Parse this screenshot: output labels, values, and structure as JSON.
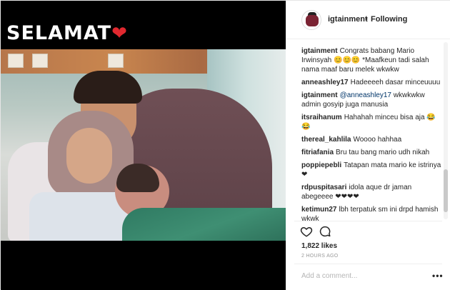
{
  "post": {
    "overlay_text": "SELAMAT",
    "overlay_heart": "❤",
    "image_alt": "couple with newborn baby in hospital bed"
  },
  "header": {
    "username": "igtainment",
    "separator": "•",
    "follow_label": "Following",
    "avatar_icon": "avatar-logo"
  },
  "comments": [
    {
      "user": "igtainment",
      "text": "Congrats babang Mario Irwinsyah 😊😊😊 *Maafkeun tadi salah nama maaf baru melek wkwkw"
    },
    {
      "user": "anneashley17",
      "text": "Hadeeeeh dasar minceuuuu"
    },
    {
      "user": "igtainment",
      "mention": "@anneashley17",
      "text": " wkwkwkw admin gosyip juga manusia"
    },
    {
      "user": "itsraihanum",
      "text": "Hahahah minceu bisa aja 😂😂"
    },
    {
      "user": "thereal_kahlila",
      "text": "Woooo hahhaa"
    },
    {
      "user": "fitriafania",
      "text": "Bru tau bang mario udh nikah"
    },
    {
      "user": "poppiepebli",
      "text": "Tatapan mata mario ke istrinya❤"
    },
    {
      "user": "rdpuspitasari",
      "text": "idola aque dr jaman abegeeee ❤❤❤❤"
    },
    {
      "user": "ketimun27",
      "text": "lbh terpatuk sm ini drpd hamish wkwk"
    }
  ],
  "actions": {
    "like_icon": "heart-icon",
    "comment_icon": "comment-bubble-icon",
    "likes_text": "1,822 likes",
    "time_text": "2 HOURS AGO"
  },
  "composer": {
    "placeholder": "Add a comment...",
    "more_label": "•••"
  },
  "colors": {
    "text": "#262626",
    "muted": "#999999",
    "mention": "#003569",
    "heart": "#e0282f",
    "media_bg": "#000000"
  }
}
